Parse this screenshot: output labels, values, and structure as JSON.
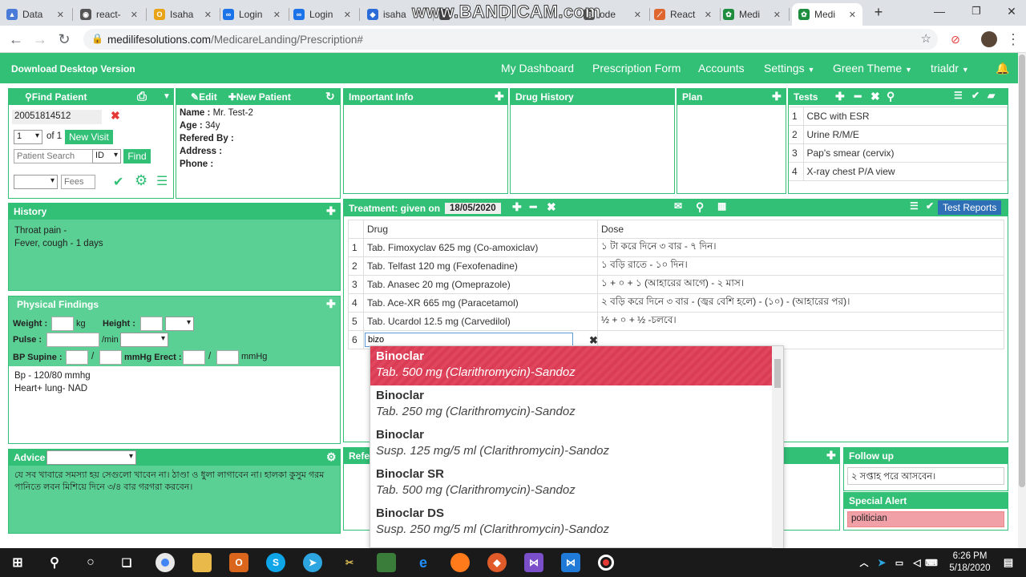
{
  "browser": {
    "tabs": [
      {
        "title": "Data",
        "color": "#4a7bd8",
        "glyph": "▲"
      },
      {
        "title": "react-",
        "color": "#555555",
        "glyph": "◉"
      },
      {
        "title": "Isaha",
        "color": "#e8a317",
        "glyph": "O"
      },
      {
        "title": "Login",
        "color": "#1a73e8",
        "glyph": "∞"
      },
      {
        "title": "Login",
        "color": "#1a73e8",
        "glyph": "∞"
      },
      {
        "title": "isaha",
        "color": "#2b6cd8",
        "glyph": "◆"
      },
      {
        "title": "",
        "color": "#444444",
        "glyph": ""
      },
      {
        "title": "ode",
        "color": "#555555",
        "glyph": "◎"
      },
      {
        "title": "React",
        "color": "#e0662f",
        "glyph": "⟋"
      },
      {
        "title": "Medi",
        "color": "#1e8e3e",
        "glyph": "✿"
      },
      {
        "title": "Medi",
        "color": "#1e8e3e",
        "glyph": "✿"
      }
    ],
    "watermark": "www.BANDICAM.com",
    "url_host": "medilifesolutions.com",
    "url_path": "/MedicareLanding/Prescription#"
  },
  "nav": {
    "brand": "Download Desktop Version",
    "items": [
      "My Dashboard",
      "Prescription Form",
      "Accounts",
      "Settings",
      "Green Theme",
      "trialdr"
    ]
  },
  "patient": {
    "find_label": "Find Patient",
    "id": "20051814512",
    "visit_num": "1",
    "visit_of": "of 1",
    "new_visit": "New Visit",
    "search_placeholder": "Patient Search",
    "search_by": "ID",
    "find_btn": "Find",
    "fees_placeholder": "Fees"
  },
  "details": {
    "edit": "Edit",
    "new_patient": "New Patient",
    "fields": [
      {
        "label": "Name :",
        "value": "Mr. Test-2"
      },
      {
        "label": "Age :",
        "value": "34y"
      },
      {
        "label": "Refered By :",
        "value": ""
      },
      {
        "label": "Address :",
        "value": ""
      },
      {
        "label": "Phone :",
        "value": ""
      }
    ]
  },
  "panels": {
    "important_info": "Important Info",
    "drug_history": "Drug History",
    "plan": "Plan",
    "tests": "Tests",
    "history": "History",
    "physical": "Physical Findings",
    "advice": "Advice",
    "follow_up": "Follow up",
    "special_alert": "Special Alert",
    "refer": "Refer"
  },
  "tests": [
    {
      "n": "1",
      "name": "CBC with ESR"
    },
    {
      "n": "2",
      "name": "Urine R/M/E"
    },
    {
      "n": "3",
      "name": "Pap's smear (cervix)"
    },
    {
      "n": "4",
      "name": "X-ray chest P/A view"
    }
  ],
  "history": [
    "Throat pain -",
    "Fever, cough - 1 days"
  ],
  "physical": {
    "weight": "Weight :",
    "kg": "kg",
    "height": "Height :",
    "pulse": "Pulse :",
    "per_min": "/min",
    "bp": "BP Supine :",
    "slash": "/",
    "mmhg_erect": "mmHg Erect :",
    "mmhg": "mmHg",
    "notes": [
      "Bp - 120/80 mmhg",
      "Heart+ lung- NAD"
    ]
  },
  "advice_text": "যে সব খাবারে সমস্যা হয় সেগুলো খাবেন না। ঠাণ্ডা ও ধুলা লাগাবেন না। হালকা কুসুম গরম পানিতে লবন মিশিয়ে দিনে ৩/৪ বার গরগরা করবেন।",
  "treatment": {
    "title": "Treatment: given on",
    "date": "18/05/2020",
    "test_reports": "Test Reports",
    "col_drug": "Drug",
    "col_dose": "Dose",
    "rows": [
      {
        "n": "1",
        "drug": "Tab. Fimoxyclav  625 mg (Co-amoxiclav)",
        "dose": "১ টা করে দিনে ৩ বার - ৭ দিন।"
      },
      {
        "n": "2",
        "drug": "Tab. Telfast 120 mg (Fexofenadine)",
        "dose": "১ বড়ি রাতে - ১০ দিন।"
      },
      {
        "n": "3",
        "drug": "Tab. Anasec 20 mg (Omeprazole)",
        "dose": "১ + ০ + ১ (আহারের আগে) - ২ মাস।"
      },
      {
        "n": "4",
        "drug": "Tab. Ace-XR 665 mg (Paracetamol)",
        "dose": "২ বড়ি করে দিনে ৩ বার - (জ্বর বেশি হলে)  - (১০) - (আহারের পর)।"
      },
      {
        "n": "5",
        "drug": "Tab. Ucardol 12.5 mg (Carvedilol)",
        "dose": "½ + ০ + ½ -চলবে।"
      }
    ],
    "new_row_n": "6",
    "new_row_value": "bizo"
  },
  "dropdown": [
    {
      "name": "Binoclar",
      "desc": "Tab. 500 mg (Clarithromycin)-Sandoz"
    },
    {
      "name": "Binoclar",
      "desc": "Tab. 250 mg (Clarithromycin)-Sandoz"
    },
    {
      "name": "Binoclar",
      "desc": "Susp. 125 mg/5 ml (Clarithromycin)-Sandoz"
    },
    {
      "name": "Binoclar SR",
      "desc": "Tab. 500 mg (Clarithromycin)-Sandoz"
    },
    {
      "name": "Binoclar DS",
      "desc": "Susp. 250 mg/5 ml (Clarithromycin)-Sandoz"
    },
    {
      "name": "Binoclar",
      "desc": ""
    }
  ],
  "follow_up_text": "২ সপ্তাহ পরে আসবেন।",
  "special_alert_text": "politician",
  "taskbar": {
    "time": "6:26 PM",
    "date": "5/18/2020"
  },
  "colors": {
    "brand_green": "#32bf76",
    "panel_green": "#5bd094",
    "highlight_red": "#e0475e"
  }
}
